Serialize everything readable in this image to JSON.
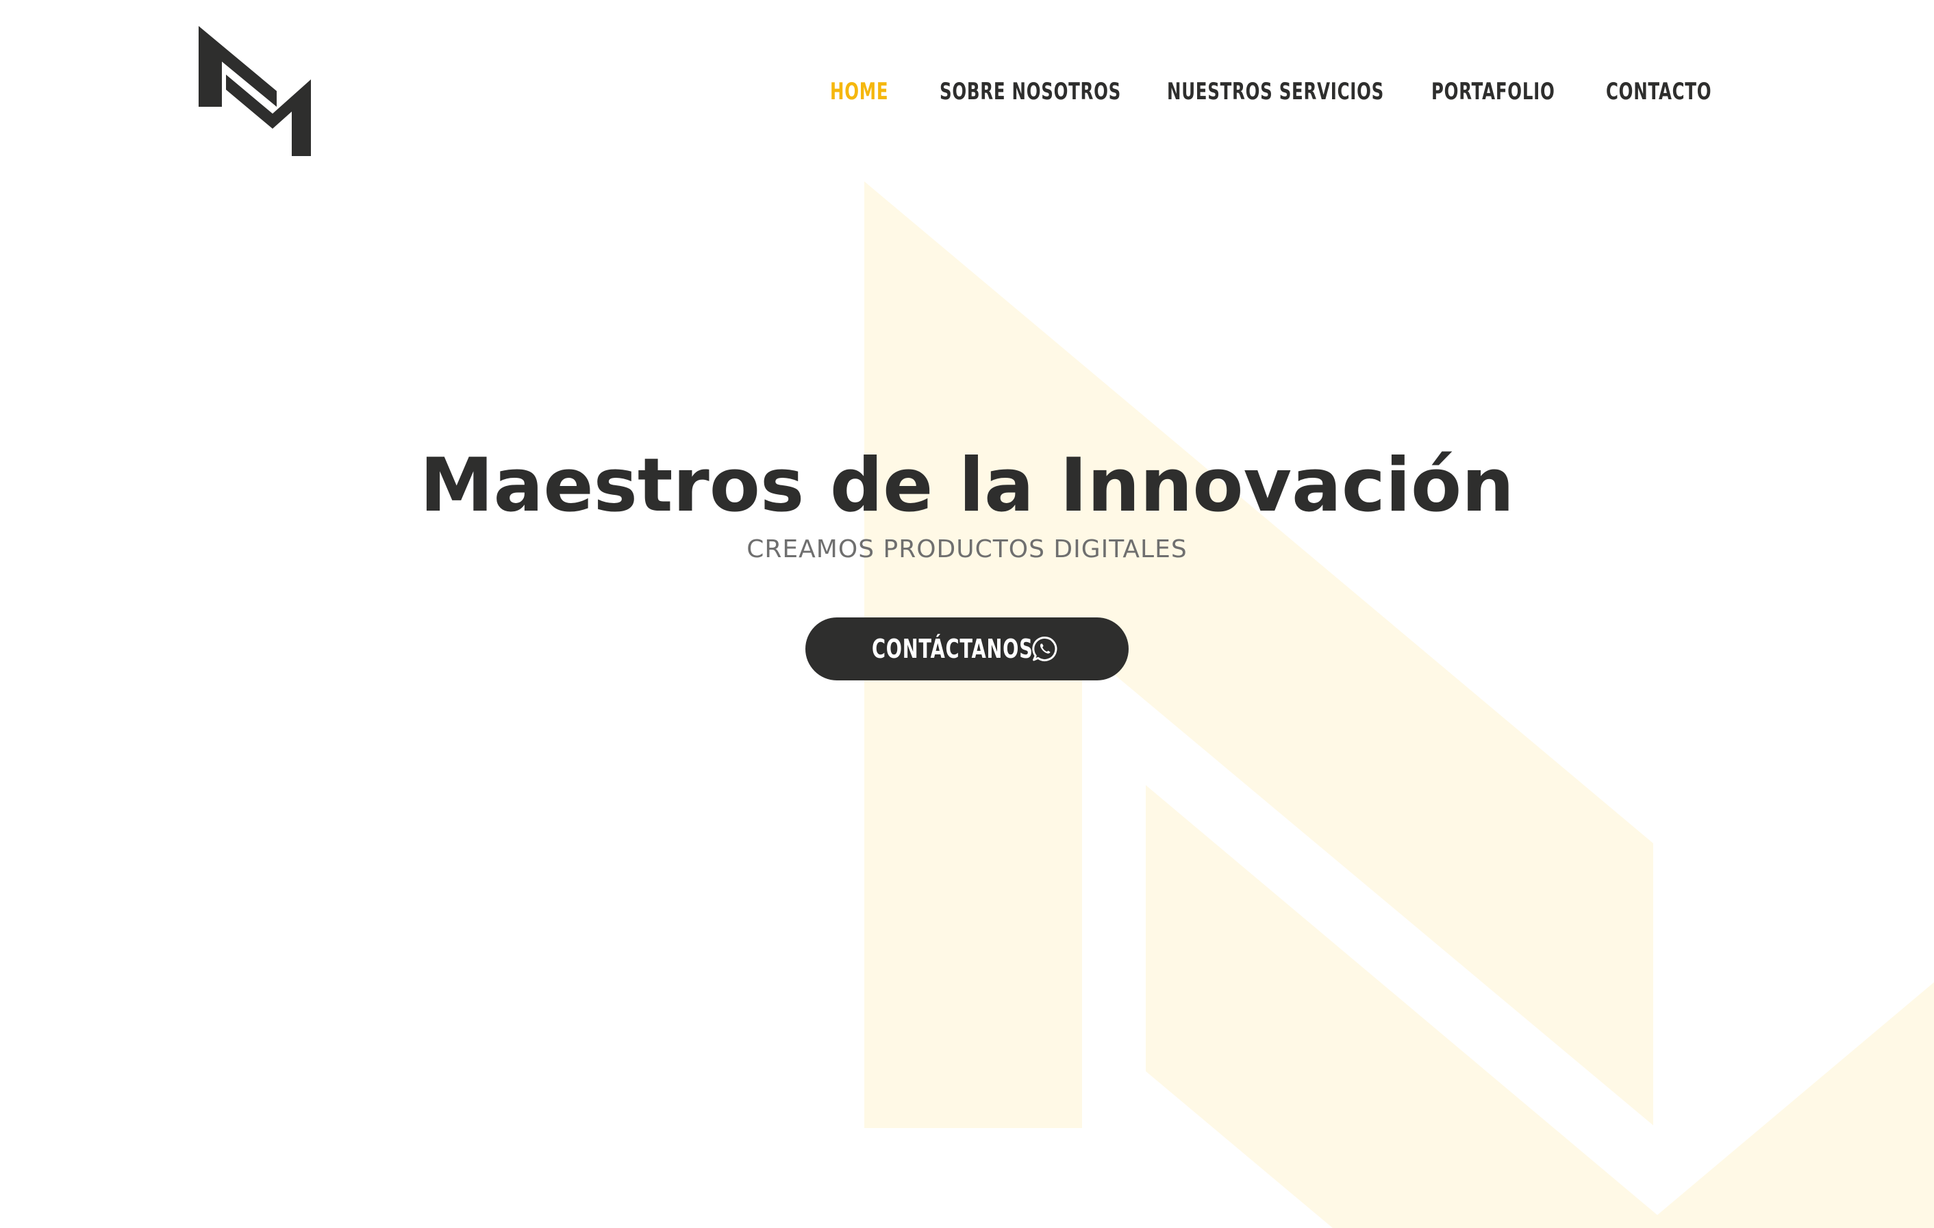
{
  "brand": {
    "logo_icon": "mm-monogram-logo",
    "primary_dark": "#2e2e2d",
    "accent": "#f5b70e",
    "watermark_tint": "#fff9e6"
  },
  "nav": {
    "items": [
      {
        "label": "HOME",
        "active": true
      },
      {
        "label": "SOBRE NOSOTROS",
        "active": false
      },
      {
        "label": "NUESTROS SERVICIOS",
        "active": false
      },
      {
        "label": "PORTAFOLIO",
        "active": false
      },
      {
        "label": "CONTACTO",
        "active": false
      }
    ]
  },
  "hero": {
    "title": "Maestros de la Innovación",
    "subtitle": "CREAMOS PRODUCTOS DIGITALES",
    "cta_label": "CONTÁCTANOS",
    "cta_icon": "whatsapp-icon"
  }
}
